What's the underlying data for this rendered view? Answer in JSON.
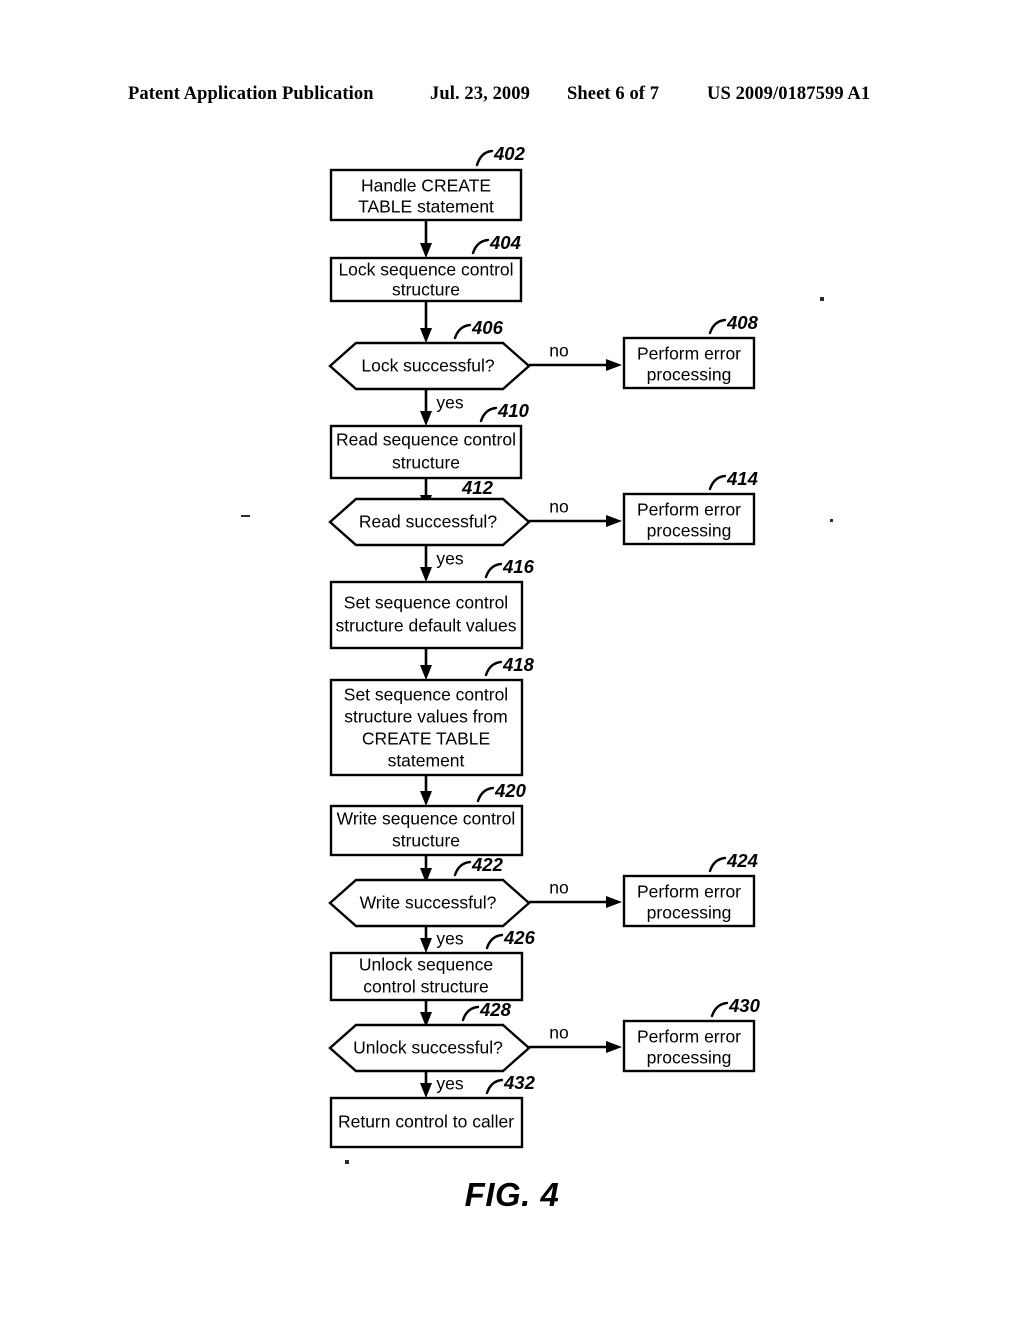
{
  "header": {
    "publication": "Patent Application Publication",
    "date": "Jul. 23, 2009",
    "sheet": "Sheet 6 of 7",
    "doc_number": "US 2009/0187599 A1"
  },
  "figure": {
    "caption": "FIG. 4"
  },
  "chart_data": {
    "type": "diagram",
    "diagram_kind": "flowchart",
    "title": "FIG. 4",
    "nodes": [
      {
        "ref": "402",
        "shape": "process",
        "lines": [
          "Handle CREATE",
          "TABLE statement"
        ]
      },
      {
        "ref": "404",
        "shape": "process",
        "lines": [
          "Lock sequence control",
          "structure"
        ]
      },
      {
        "ref": "406",
        "shape": "decision",
        "lines": [
          "Lock successful?"
        ]
      },
      {
        "ref": "408",
        "shape": "process",
        "lines": [
          "Perform error",
          "processing"
        ]
      },
      {
        "ref": "410",
        "shape": "process",
        "lines": [
          "Read sequence control",
          "structure"
        ]
      },
      {
        "ref": "412",
        "shape": "decision",
        "lines": [
          "Read successful?"
        ]
      },
      {
        "ref": "414",
        "shape": "process",
        "lines": [
          "Perform error",
          "processing"
        ]
      },
      {
        "ref": "416",
        "shape": "process",
        "lines": [
          "Set sequence control",
          "structure default values"
        ]
      },
      {
        "ref": "418",
        "shape": "process",
        "lines": [
          "Set sequence control",
          "structure values from",
          "CREATE TABLE",
          "statement"
        ]
      },
      {
        "ref": "420",
        "shape": "process",
        "lines": [
          "Write sequence control",
          "structure"
        ]
      },
      {
        "ref": "422",
        "shape": "decision",
        "lines": [
          "Write successful?"
        ]
      },
      {
        "ref": "424",
        "shape": "process",
        "lines": [
          "Perform error",
          "processing"
        ]
      },
      {
        "ref": "426",
        "shape": "process",
        "lines": [
          "Unlock sequence",
          "control structure"
        ]
      },
      {
        "ref": "428",
        "shape": "decision",
        "lines": [
          "Unlock successful?"
        ]
      },
      {
        "ref": "430",
        "shape": "process",
        "lines": [
          "Perform error",
          "processing"
        ]
      },
      {
        "ref": "432",
        "shape": "process",
        "lines": [
          "Return control to caller"
        ]
      }
    ],
    "edges": [
      {
        "from": "402",
        "to": "404",
        "label": ""
      },
      {
        "from": "404",
        "to": "406",
        "label": ""
      },
      {
        "from": "406",
        "to": "408",
        "label": "no"
      },
      {
        "from": "406",
        "to": "410",
        "label": "yes"
      },
      {
        "from": "410",
        "to": "412",
        "label": ""
      },
      {
        "from": "412",
        "to": "414",
        "label": "no"
      },
      {
        "from": "412",
        "to": "416",
        "label": "yes"
      },
      {
        "from": "416",
        "to": "418",
        "label": ""
      },
      {
        "from": "418",
        "to": "420",
        "label": ""
      },
      {
        "from": "420",
        "to": "422",
        "label": ""
      },
      {
        "from": "422",
        "to": "424",
        "label": "no"
      },
      {
        "from": "422",
        "to": "426",
        "label": "yes"
      },
      {
        "from": "426",
        "to": "428",
        "label": ""
      },
      {
        "from": "428",
        "to": "430",
        "label": "no"
      },
      {
        "from": "428",
        "to": "432",
        "label": "yes"
      }
    ]
  },
  "nodes": {
    "n402": {
      "l1": "Handle CREATE",
      "l2": "TABLE statement",
      "ref": "402"
    },
    "n404": {
      "l1": "Lock sequence control",
      "l2": "structure",
      "ref": "404"
    },
    "n406": {
      "l1": "Lock successful?",
      "ref": "406"
    },
    "n408": {
      "l1": "Perform error",
      "l2": "processing",
      "ref": "408"
    },
    "n410": {
      "l1": "Read sequence control",
      "l2": "structure",
      "ref": "410"
    },
    "n412": {
      "l1": "Read successful?",
      "ref": "412"
    },
    "n414": {
      "l1": "Perform error",
      "l2": "processing",
      "ref": "414"
    },
    "n416": {
      "l1": "Set sequence control",
      "l2": "structure default values",
      "ref": "416"
    },
    "n418": {
      "l1": "Set sequence control",
      "l2": "structure values from",
      "l3": "CREATE TABLE",
      "l4": "statement",
      "ref": "418"
    },
    "n420": {
      "l1": "Write sequence control",
      "l2": "structure",
      "ref": "420"
    },
    "n422": {
      "l1": "Write successful?",
      "ref": "422"
    },
    "n424": {
      "l1": "Perform error",
      "l2": "processing",
      "ref": "424"
    },
    "n426": {
      "l1": "Unlock sequence",
      "l2": "control structure",
      "ref": "426"
    },
    "n428": {
      "l1": "Unlock successful?",
      "ref": "428"
    },
    "n430": {
      "l1": "Perform error",
      "l2": "processing",
      "ref": "430"
    },
    "n432": {
      "l1": "Return control to caller",
      "ref": "432"
    }
  },
  "branch_labels": {
    "no_406": "no",
    "yes_406": "yes",
    "no_412": "no",
    "yes_412": "yes",
    "no_422": "no",
    "yes_422": "yes",
    "no_428": "no",
    "yes_428": "yes"
  }
}
